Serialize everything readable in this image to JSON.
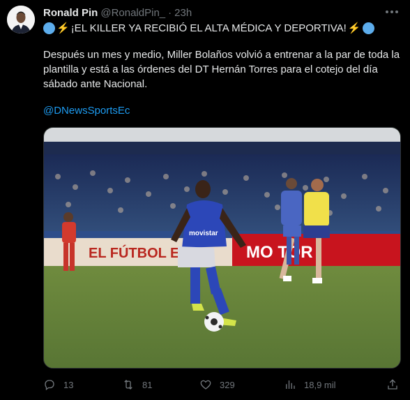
{
  "tweet": {
    "author_name": "Ronald Pin",
    "author_handle": "@RonaldPin_",
    "separator": "·",
    "time": "23h",
    "headline": "¡EL KILLER YA RECIBIÓ EL ALTA MÉDICA Y DEPORTIVA!",
    "body": "Después un mes y medio, Miller Bolaños volvió a entrenar a la par de toda la plantilla y está a las órdenes del DT Hernán Torres para el cotejo del día sábado ante Nacional.",
    "mention": "@DNewsSportsEc",
    "media": {
      "banner_left": "EL FÚTBOL E",
      "banner_right": "MO  TOR",
      "jersey_text": "movistar"
    }
  },
  "actions": {
    "replies": "13",
    "retweets": "81",
    "likes": "329",
    "views": "18,9 mil"
  },
  "icons": {
    "more": "more-dots-icon",
    "reply": "reply-icon",
    "retweet": "retweet-icon",
    "like": "heart-icon",
    "views": "views-chart-icon",
    "share": "share-icon",
    "emoji_circle": "blue-circle-emoji",
    "emoji_bolt": "lightning-emoji"
  },
  "colors": {
    "background": "#000000",
    "link": "#1d9bf0",
    "muted": "#71767b",
    "text": "#e7e9ea"
  }
}
